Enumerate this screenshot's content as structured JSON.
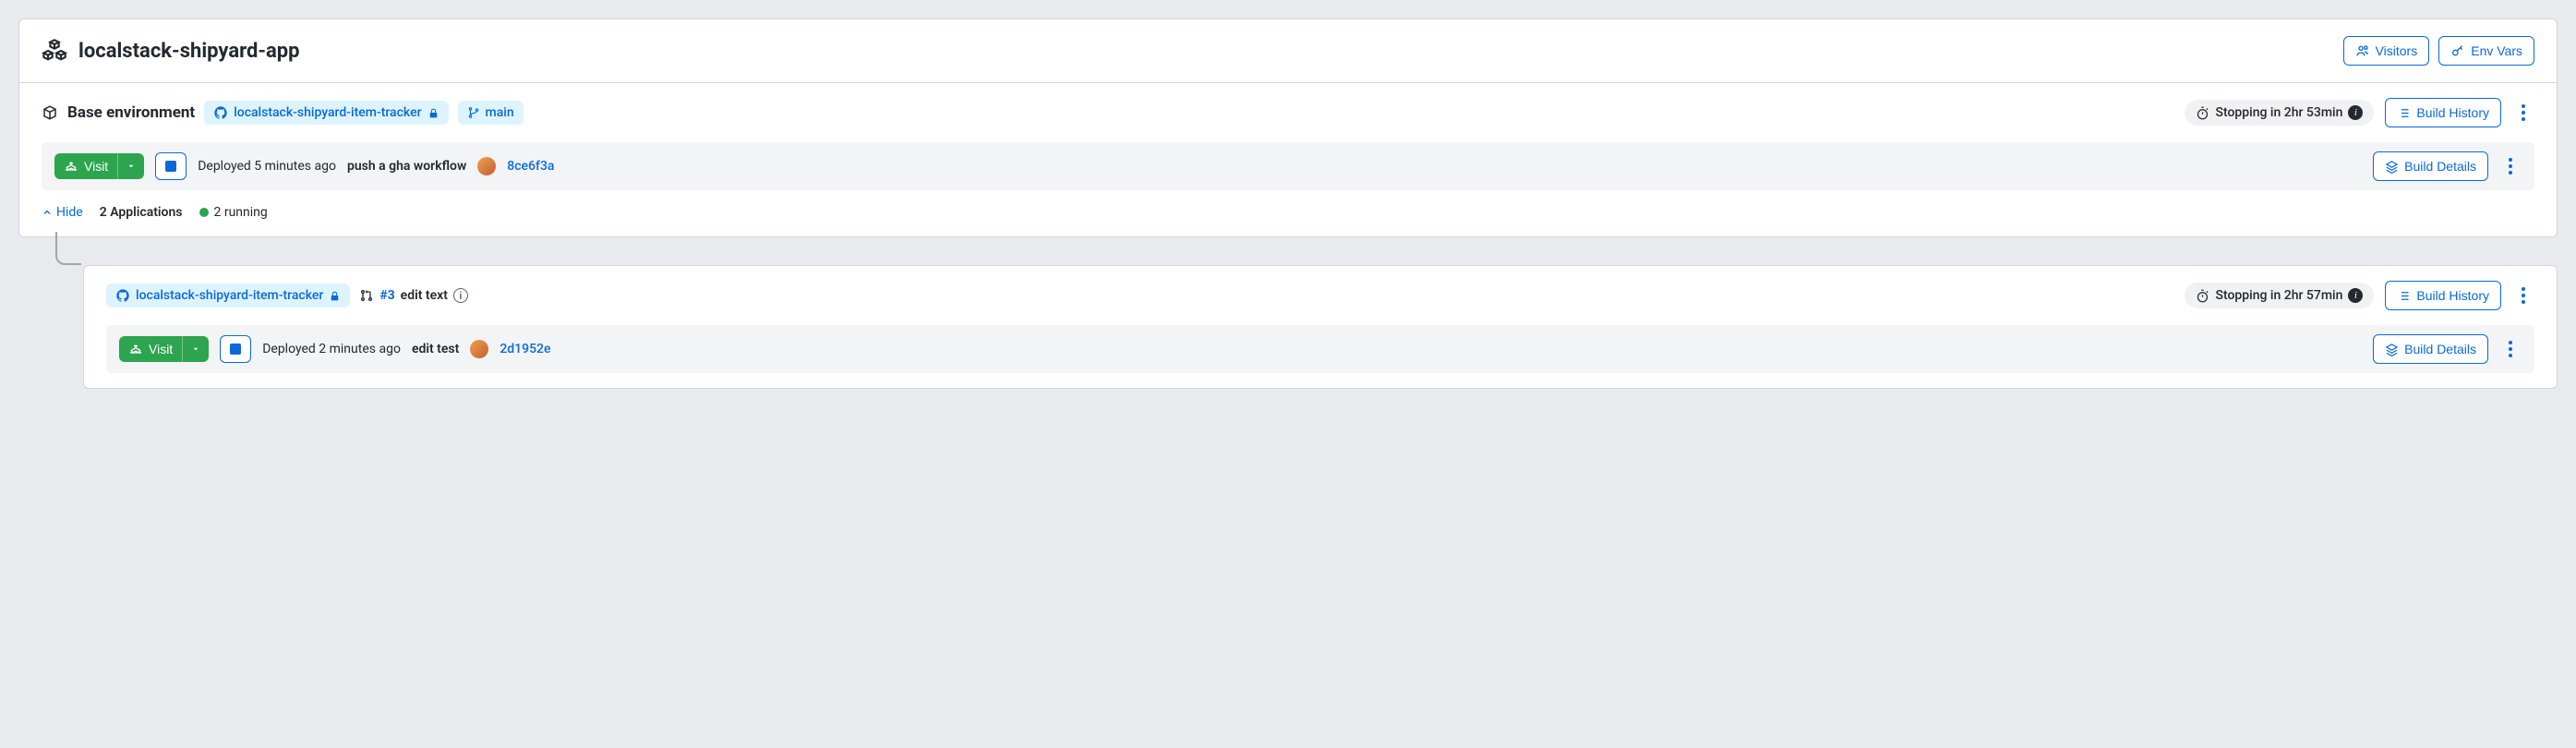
{
  "app": {
    "title": "localstack-shipyard-app",
    "visitors_label": "Visitors",
    "envvars_label": "Env Vars"
  },
  "base_env": {
    "label": "Base environment",
    "repo_name": "localstack-shipyard-item-tracker",
    "branch": "main",
    "stopping_text": "Stopping in 2hr 53min",
    "build_history_label": "Build History",
    "deploy": {
      "visit_label": "Visit",
      "deployed_text": "Deployed 5 minutes ago",
      "commit_message": "push a gha workflow",
      "commit_hash": "8ce6f3a",
      "build_details_label": "Build Details"
    },
    "hide_label": "Hide",
    "apps_count": "2 Applications",
    "running_text": "2 running"
  },
  "pr_env": {
    "repo_name": "localstack-shipyard-item-tracker",
    "pr_number": "#3",
    "pr_title": "edit text",
    "stopping_text": "Stopping in 2hr 57min",
    "build_history_label": "Build History",
    "deploy": {
      "visit_label": "Visit",
      "deployed_text": "Deployed 2 minutes ago",
      "commit_message": "edit test",
      "commit_hash": "2d1952e",
      "build_details_label": "Build Details"
    }
  }
}
